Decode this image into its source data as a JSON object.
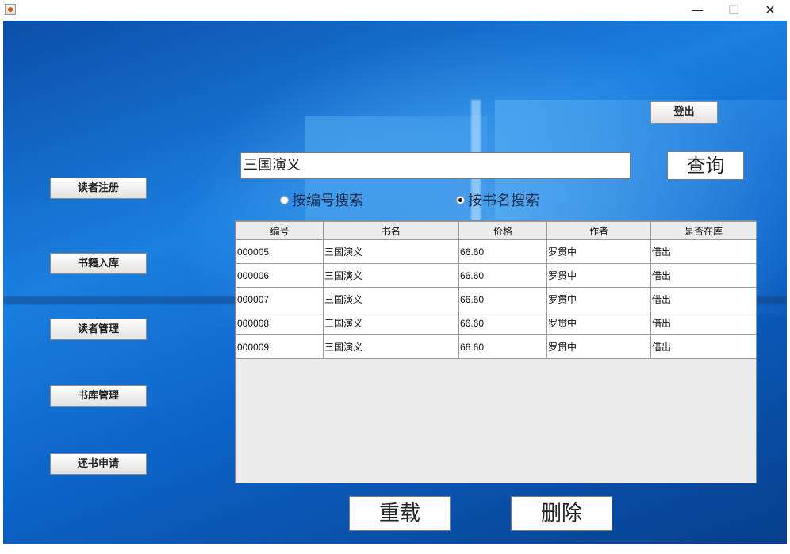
{
  "sidebar": {
    "items": [
      {
        "label": "读者注册"
      },
      {
        "label": "书籍入库"
      },
      {
        "label": "读者管理"
      },
      {
        "label": "书库管理"
      },
      {
        "label": "还书申请"
      }
    ]
  },
  "header": {
    "logout_label": "登出"
  },
  "search": {
    "value": "三国演义",
    "query_label": "查询",
    "options": [
      {
        "label": "按编号搜索",
        "selected": false
      },
      {
        "label": "按书名搜索",
        "selected": true
      }
    ]
  },
  "table": {
    "columns": [
      "编号",
      "书名",
      "价格",
      "作者",
      "是否在库"
    ],
    "rows": [
      [
        "000005",
        "三国演义",
        "66.60",
        "罗贯中",
        "借出"
      ],
      [
        "000006",
        "三国演义",
        "66.60",
        "罗贯中",
        "借出"
      ],
      [
        "000007",
        "三国演义",
        "66.60",
        "罗贯中",
        "借出"
      ],
      [
        "000008",
        "三国演义",
        "66.60",
        "罗贯中",
        "借出"
      ],
      [
        "000009",
        "三国演义",
        "66.60",
        "罗贯中",
        "借出"
      ]
    ]
  },
  "actions": {
    "reload_label": "重载",
    "delete_label": "删除"
  },
  "window": {
    "minimize_glyph": "—",
    "maximize_glyph": "☐",
    "close_glyph": "✕"
  },
  "colors": {
    "background_blue": "#1b7fe0",
    "button_face": "#e2e2e2"
  }
}
